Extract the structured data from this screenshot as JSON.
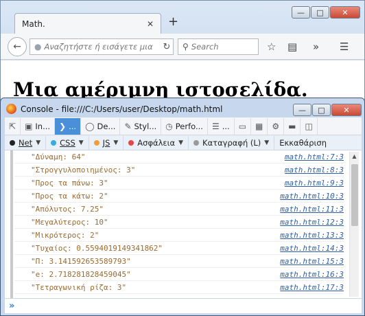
{
  "browser": {
    "tab_title": "Math.",
    "tab_close": "✕",
    "new_tab": "+",
    "url_placeholder": "Αναζητήστε ή εισάγετε μια",
    "search_placeholder": "Search",
    "page_heading": "Μια αμέριμνη ιστοσελίδα."
  },
  "console": {
    "title": "Console - file:///C:/Users/user/Desktop/math.html",
    "toolbar": [
      {
        "label": "In...",
        "icon": "inspector-icon"
      },
      {
        "label": "...",
        "icon": "console-icon",
        "active": true
      },
      {
        "label": "De...",
        "icon": "debugger-icon"
      },
      {
        "label": "Styl...",
        "icon": "style-editor-icon"
      },
      {
        "label": "Perfo...",
        "icon": "performance-icon"
      },
      {
        "label": "...",
        "icon": "network-monitor-icon"
      }
    ],
    "filters": [
      {
        "label": "Net",
        "color": "#222222"
      },
      {
        "label": "CSS",
        "color": "#39a9e0"
      },
      {
        "label": "JS",
        "color": "#f29d38"
      },
      {
        "label": "Ασφάλεια",
        "color": "#e84545"
      },
      {
        "label": "Καταγραφή (L)",
        "color": "#9a9a9a"
      }
    ],
    "clear_label": "Εκκαθάριση",
    "messages": [
      {
        "text": "\"Δύναμη: 64\"",
        "src": "math.html:7:3"
      },
      {
        "text": "\"Στρογγυλοποιημένος: 3\"",
        "src": "math.html:8:3"
      },
      {
        "text": "\"Προς τα πάνω: 3\"",
        "src": "math.html:9:3"
      },
      {
        "text": "\"Προς τα κάτω: 2\"",
        "src": "math.html:10:3"
      },
      {
        "text": "\"Απόλυτος: 7.25\"",
        "src": "math.html:11:3"
      },
      {
        "text": "\"Μεγαλύτερος: 10\"",
        "src": "math.html:12:3"
      },
      {
        "text": "\"Μικρότερος: 2\"",
        "src": "math.html:13:3"
      },
      {
        "text": "\"Τυχαίος: 0.5594019149341862\"",
        "src": "math.html:14:3"
      },
      {
        "text": "\"Π: 3.141592653589793\"",
        "src": "math.html:15:3"
      },
      {
        "text": "\"e: 2.718281828459045\"",
        "src": "math.html:16:3"
      },
      {
        "text": "\"Τετραγωνική ρίζα: 3\"",
        "src": "math.html:17:3"
      }
    ],
    "prompt": "»"
  }
}
